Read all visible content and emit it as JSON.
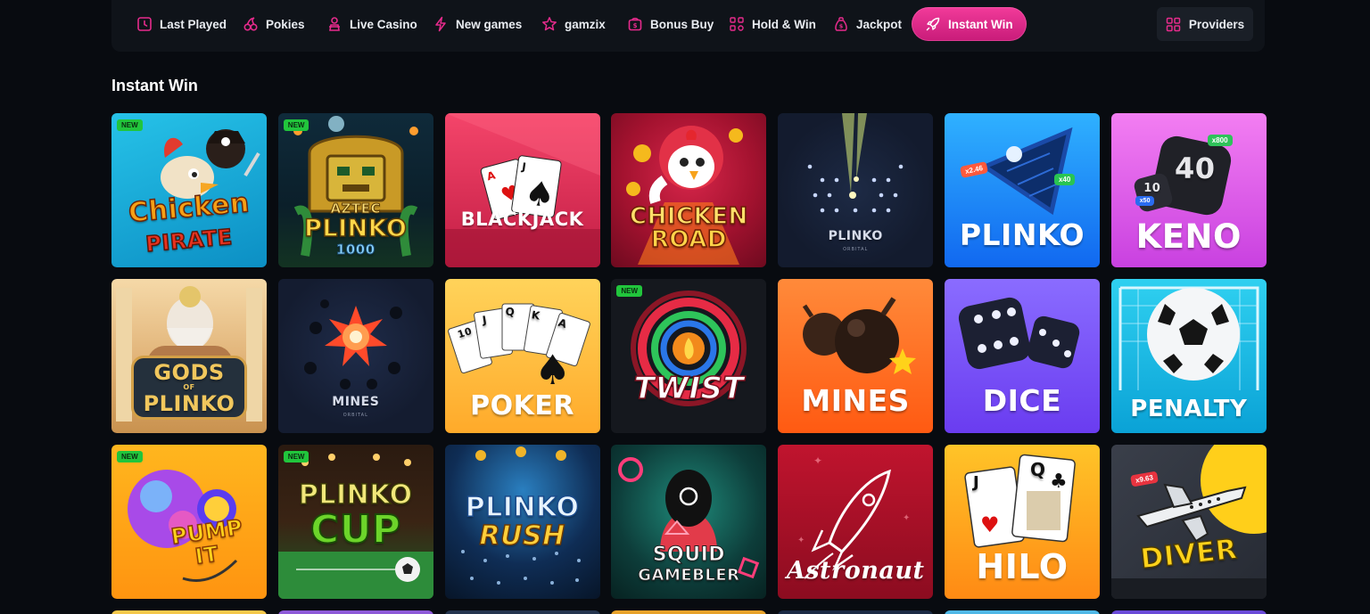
{
  "nav": {
    "items": [
      {
        "label": "Last Played",
        "icon": "clock-icon"
      },
      {
        "label": "Pokies",
        "icon": "cherries-icon"
      },
      {
        "label": "Live Casino",
        "icon": "dealer-icon"
      },
      {
        "label": "New games",
        "icon": "lightning-icon"
      },
      {
        "label": "gamzix",
        "icon": "star-icon"
      },
      {
        "label": "Bonus Buy",
        "icon": "gift-box-icon"
      },
      {
        "label": "Hold & Win",
        "icon": "grid-dots-icon"
      },
      {
        "label": "Jackpot",
        "icon": "money-bag-icon"
      },
      {
        "label": "Instant Win",
        "icon": "rocket-icon",
        "active": true
      }
    ],
    "providers_label": "Providers",
    "accent": "#e62b8c"
  },
  "section": {
    "title": "Instant Win"
  },
  "badge_new": "NEW",
  "games": [
    {
      "name": "Chicken Pirate",
      "title_line1": "Chicken",
      "title_line2": "PIRATE",
      "new": true
    },
    {
      "name": "Aztec Plinko 1000",
      "title_line1": "AZTEC",
      "title_line2": "PLINKO",
      "title_line3": "1000",
      "new": true
    },
    {
      "name": "Blackjack",
      "title_line1": "BLACKJACK"
    },
    {
      "name": "Chicken Road",
      "title_line1": "CHICKEN",
      "title_line2": "ROAD"
    },
    {
      "name": "Plinko Orbital",
      "title_line1": "PLINKO",
      "subtitle": "ORBITAL"
    },
    {
      "name": "Plinko",
      "title_line1": "PLINKO",
      "mult_a": "x2.46",
      "mult_b": "x40"
    },
    {
      "name": "Keno",
      "title_line1": "KENO",
      "mult_a": "x800",
      "mult_b": "x50",
      "ball_a": "40",
      "ball_b": "10"
    },
    {
      "name": "Gods of Plinko",
      "title_line1": "GODS",
      "title_of": "OF",
      "title_line2": "PLINKO"
    },
    {
      "name": "Mines Orbital",
      "title_line1": "MINES",
      "subtitle": "ORBITAL"
    },
    {
      "name": "Poker",
      "title_line1": "POKER",
      "cards": [
        "10",
        "J",
        "Q",
        "K",
        "A"
      ]
    },
    {
      "name": "Twist",
      "title_line1": "TWIST",
      "new": true
    },
    {
      "name": "Mines",
      "title_line1": "MINES"
    },
    {
      "name": "Dice",
      "title_line1": "DICE"
    },
    {
      "name": "Penalty",
      "title_line1": "PENALTY"
    },
    {
      "name": "Pump It",
      "title_line1": "PUMP",
      "title_line2": "IT",
      "new": true
    },
    {
      "name": "Plinko Cup",
      "title_line1": "PLINKO",
      "title_line2": "CUP",
      "new": true
    },
    {
      "name": "Plinko Rush",
      "title_line1": "PLINKO",
      "title_line2": "RUSH"
    },
    {
      "name": "Squid Gambler",
      "title_line1": "SQUID",
      "title_line2": "GAMEBLER"
    },
    {
      "name": "Astronaut",
      "title_line1": "Astronaut"
    },
    {
      "name": "Hilo",
      "title_line1": "HILO",
      "card_a": "J",
      "card_b": "Q"
    },
    {
      "name": "Diver",
      "title_line1": "DIVER",
      "mult_a": "x9.63"
    }
  ]
}
